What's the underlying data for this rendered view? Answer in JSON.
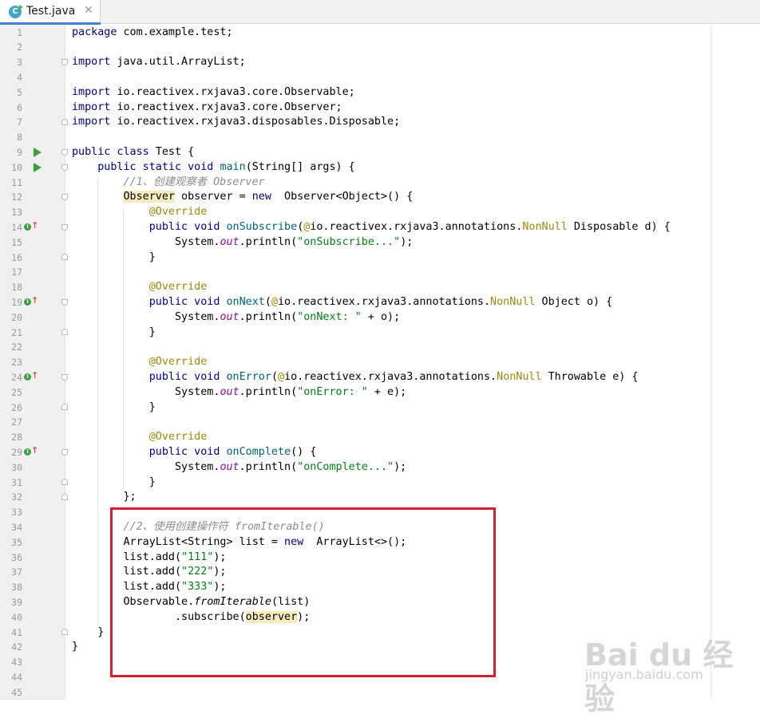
{
  "tab": {
    "title": "Test.java",
    "icon": "java-class-icon",
    "close": "✕"
  },
  "watermark": {
    "logo": "Bai du 经验",
    "sub": "jingyan.baidu.com"
  },
  "code": [
    {
      "n": "1",
      "t": [
        [
          "kw",
          "package"
        ],
        [
          "",
          "com.example.test;"
        ]
      ]
    },
    {
      "n": "2",
      "t": []
    },
    {
      "n": "3",
      "t": [
        [
          "kw",
          "import"
        ],
        [
          "",
          "java.util.ArrayList;"
        ]
      ]
    },
    {
      "n": "4",
      "t": []
    },
    {
      "n": "5",
      "t": [
        [
          "kw",
          "import"
        ],
        [
          "",
          "io.reactivex.rxjava3.core.Observable;"
        ]
      ]
    },
    {
      "n": "6",
      "t": [
        [
          "kw",
          "import"
        ],
        [
          "",
          "io.reactivex.rxjava3.core.Observer;"
        ]
      ]
    },
    {
      "n": "7",
      "t": [
        [
          "kw",
          "import"
        ],
        [
          "",
          "io.reactivex.rxjava3.disposables.Disposable;"
        ]
      ]
    },
    {
      "n": "8",
      "t": []
    },
    {
      "n": "9",
      "t": [
        [
          "kw",
          "public class"
        ],
        [
          "",
          "Test {"
        ]
      ]
    },
    {
      "n": "10",
      "t": [
        [
          "",
          "    "
        ],
        [
          "kw",
          "public static void"
        ],
        [
          "mn",
          "main"
        ],
        [
          "",
          "(String[] args) {"
        ]
      ]
    },
    {
      "n": "11",
      "t": [
        [
          "",
          "        "
        ],
        [
          "cm",
          "//1、创建观察者 Observer"
        ]
      ]
    },
    {
      "n": "12",
      "t": [
        [
          "",
          "        "
        ],
        [
          "hl",
          "Observer"
        ],
        [
          "",
          " observer = "
        ],
        [
          "kw",
          "new"
        ],
        [
          "",
          " Observer<Object>() {"
        ]
      ]
    },
    {
      "n": "13",
      "t": [
        [
          "",
          "            "
        ],
        [
          "an",
          "@Override"
        ]
      ]
    },
    {
      "n": "14",
      "t": [
        [
          "",
          "            "
        ],
        [
          "kw",
          "public void"
        ],
        [
          "mn",
          "onSubscribe"
        ],
        [
          "",
          "("
        ],
        [
          "an",
          "@"
        ],
        [
          "",
          "io.reactivex.rxjava3.annotations."
        ],
        [
          "an",
          "NonNull"
        ],
        [
          "",
          " Disposable d) {"
        ]
      ]
    },
    {
      "n": "15",
      "t": [
        [
          "",
          "                System."
        ],
        [
          "st",
          "out"
        ],
        [
          "",
          ".println("
        ],
        [
          "str",
          "\"onSubscribe...\""
        ],
        [
          "",
          ");"
        ]
      ]
    },
    {
      "n": "16",
      "t": [
        [
          "",
          "            }"
        ]
      ]
    },
    {
      "n": "17",
      "t": []
    },
    {
      "n": "18",
      "t": [
        [
          "",
          "            "
        ],
        [
          "an",
          "@Override"
        ]
      ]
    },
    {
      "n": "19",
      "t": [
        [
          "",
          "            "
        ],
        [
          "kw",
          "public void"
        ],
        [
          "mn",
          "onNext"
        ],
        [
          "",
          "("
        ],
        [
          "an",
          "@"
        ],
        [
          "",
          "io.reactivex.rxjava3.annotations."
        ],
        [
          "an",
          "NonNull"
        ],
        [
          "",
          " Object o) {"
        ]
      ]
    },
    {
      "n": "20",
      "t": [
        [
          "",
          "                System."
        ],
        [
          "st",
          "out"
        ],
        [
          "",
          ".println("
        ],
        [
          "str",
          "\"onNext: \""
        ],
        [
          "",
          " + o);"
        ]
      ]
    },
    {
      "n": "21",
      "t": [
        [
          "",
          "            }"
        ]
      ]
    },
    {
      "n": "22",
      "t": []
    },
    {
      "n": "23",
      "t": [
        [
          "",
          "            "
        ],
        [
          "an",
          "@Override"
        ]
      ]
    },
    {
      "n": "24",
      "t": [
        [
          "",
          "            "
        ],
        [
          "kw",
          "public void"
        ],
        [
          "mn",
          "onError"
        ],
        [
          "",
          "("
        ],
        [
          "an",
          "@"
        ],
        [
          "",
          "io.reactivex.rxjava3.annotations."
        ],
        [
          "an",
          "NonNull"
        ],
        [
          "",
          " Throwable e) {"
        ]
      ]
    },
    {
      "n": "25",
      "t": [
        [
          "",
          "                System."
        ],
        [
          "st",
          "out"
        ],
        [
          "",
          ".println("
        ],
        [
          "str",
          "\"onError: \""
        ],
        [
          "",
          " + e);"
        ]
      ]
    },
    {
      "n": "26",
      "t": [
        [
          "",
          "            }"
        ]
      ]
    },
    {
      "n": "27",
      "t": []
    },
    {
      "n": "28",
      "t": [
        [
          "",
          "            "
        ],
        [
          "an",
          "@Override"
        ]
      ]
    },
    {
      "n": "29",
      "t": [
        [
          "",
          "            "
        ],
        [
          "kw",
          "public void"
        ],
        [
          "mn",
          "onComplete"
        ],
        [
          "",
          "() {"
        ]
      ]
    },
    {
      "n": "30",
      "t": [
        [
          "",
          "                System."
        ],
        [
          "st",
          "out"
        ],
        [
          "",
          ".println("
        ],
        [
          "str",
          "\"onComplete...\""
        ],
        [
          "",
          ");"
        ]
      ]
    },
    {
      "n": "31",
      "t": [
        [
          "",
          "            }"
        ]
      ]
    },
    {
      "n": "32",
      "t": [
        [
          "",
          "        };"
        ]
      ]
    },
    {
      "n": "33",
      "t": []
    },
    {
      "n": "34",
      "t": [
        [
          "",
          "        "
        ],
        [
          "cm",
          "//2、使用创建操作符 fromIterable()"
        ]
      ]
    },
    {
      "n": "35",
      "t": [
        [
          "",
          "        ArrayList<String> list = "
        ],
        [
          "kw",
          "new"
        ],
        [
          "",
          " ArrayList<>();"
        ]
      ]
    },
    {
      "n": "36",
      "t": [
        [
          "",
          "        list.add("
        ],
        [
          "str",
          "\"111\""
        ],
        [
          "",
          ");"
        ]
      ]
    },
    {
      "n": "37",
      "t": [
        [
          "",
          "        list.add("
        ],
        [
          "str",
          "\"222\""
        ],
        [
          "",
          ");"
        ]
      ]
    },
    {
      "n": "38",
      "t": [
        [
          "",
          "        list.add("
        ],
        [
          "str",
          "\"333\""
        ],
        [
          "",
          ");"
        ]
      ]
    },
    {
      "n": "39",
      "t": [
        [
          "",
          "        Observable."
        ],
        [
          "it",
          "fromIterable"
        ],
        [
          "",
          "(list)"
        ]
      ]
    },
    {
      "n": "40",
      "t": [
        [
          "",
          "                .subscribe("
        ],
        [
          "hl",
          "observer"
        ],
        [
          "",
          ");"
        ]
      ]
    },
    {
      "n": "41",
      "t": [
        [
          "",
          "    }"
        ]
      ]
    },
    {
      "n": "42",
      "t": [
        [
          "",
          "}"
        ]
      ]
    },
    {
      "n": "43",
      "t": []
    },
    {
      "n": "44",
      "t": []
    },
    {
      "n": "45",
      "t": []
    }
  ],
  "gutter": {
    "run": [
      "9",
      "10"
    ],
    "implements": [
      "14",
      "19",
      "24",
      "29"
    ],
    "fold_open": [
      "3",
      "9",
      "10",
      "12",
      "14",
      "19",
      "24",
      "29"
    ],
    "fold_close": [
      "7",
      "16",
      "21",
      "26",
      "31",
      "32",
      "41"
    ]
  }
}
